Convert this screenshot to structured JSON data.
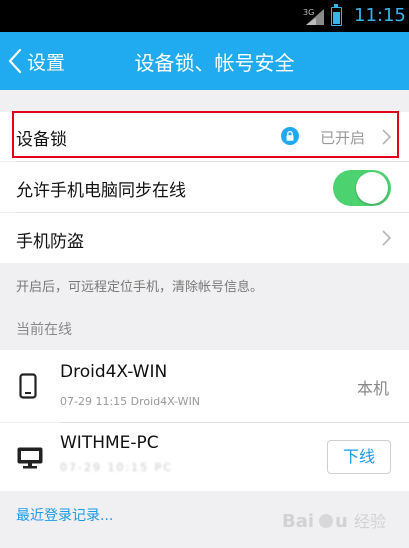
{
  "status_bar": {
    "network": "3G",
    "time": "11:15",
    "accent": "#36b5ea"
  },
  "nav": {
    "back_label": "设置",
    "title": "设备锁、帐号安全",
    "color": "#20aaf0"
  },
  "settings": {
    "device_lock": {
      "label": "设备锁",
      "status": "已开启"
    },
    "sync_online": {
      "label": "允许手机电脑同步在线",
      "enabled": true
    },
    "anti_theft": {
      "label": "手机防盗",
      "hint": "开启后，可远程定位手机，清除帐号信息。"
    }
  },
  "online_section": {
    "header": "当前在线",
    "devices": [
      {
        "name": "Droid4X-WIN",
        "meta": "07-29 11:15 Droid4X-WIN",
        "tag": "本机",
        "icon": "phone-icon"
      },
      {
        "name": "WITHME-PC",
        "meta": "07-29 10:15 PC",
        "action": "下线",
        "icon": "monitor-icon"
      }
    ]
  },
  "recent_login_link": "最近登录记录...",
  "watermark": "Baidu经验"
}
